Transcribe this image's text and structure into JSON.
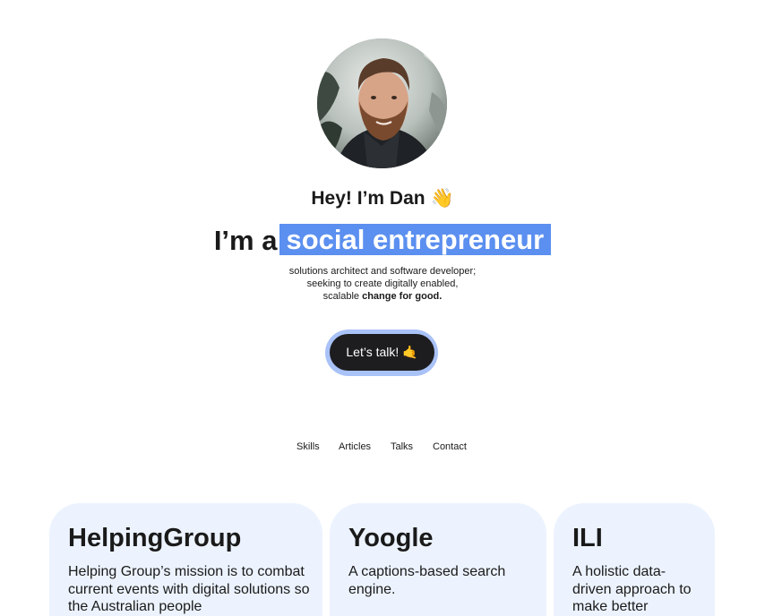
{
  "profile": {
    "avatar_alt": "Photo of Dan",
    "greeting": "Hey! I’m Dan",
    "greeting_emoji": "👋",
    "headline_prefix": "I’m a",
    "headline_highlight": "social entrepreneur",
    "tagline_line1": "solutions architect and software developer;",
    "tagline_line2": "seeking to create digitally enabled,",
    "tagline_line3_prefix": "scalable",
    "tagline_line3_bold": "change for good."
  },
  "cta": {
    "label": "Let’s talk!",
    "emoji": "🤙"
  },
  "nav": {
    "items": [
      "Skills",
      "Articles",
      "Talks",
      "Contact"
    ]
  },
  "projects": [
    {
      "title": "HelpingGroup",
      "description": "Helping Group’s mission is to combat current events with digital solutions so the Australian people"
    },
    {
      "title": "Yoogle",
      "description": "A captions-based search engine."
    },
    {
      "title": "ILI",
      "description": "A holistic data-driven approach to make better"
    }
  ],
  "colors": {
    "highlight": "#5b8ff0",
    "cta_background": "#1d1d1f",
    "cta_ring": "#a9c2f7",
    "card_background": "#ecf3fe"
  }
}
